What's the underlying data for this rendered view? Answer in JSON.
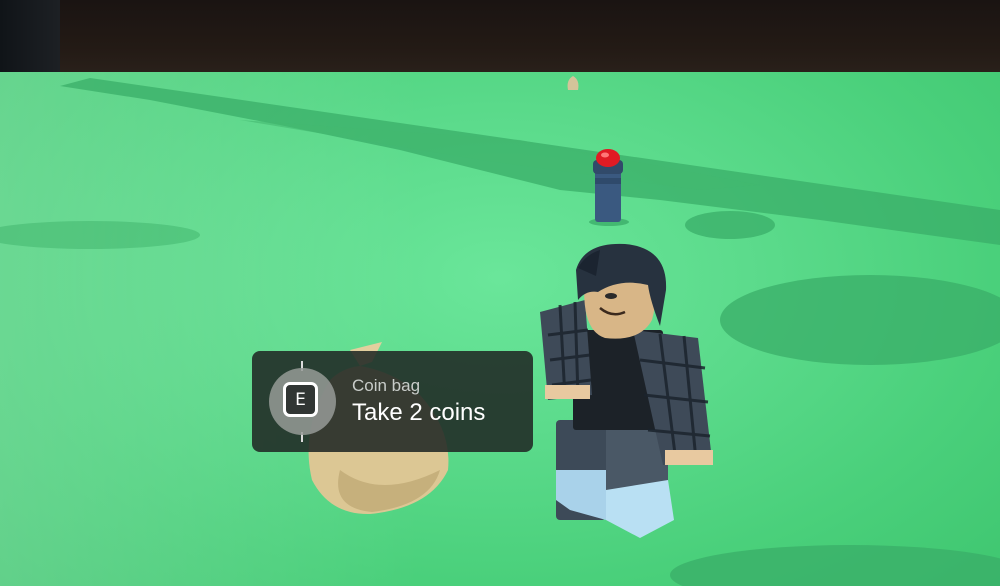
{
  "prompt": {
    "key": "E",
    "object_text": "Coin bag",
    "action_text": "Take 2 coins"
  },
  "scene": {
    "ground_color": "#4fd47f",
    "sky_color": "#1f1814",
    "prompt_bg": "#202824",
    "button_color": "#e01b24",
    "post_color": "#3c5c86"
  }
}
